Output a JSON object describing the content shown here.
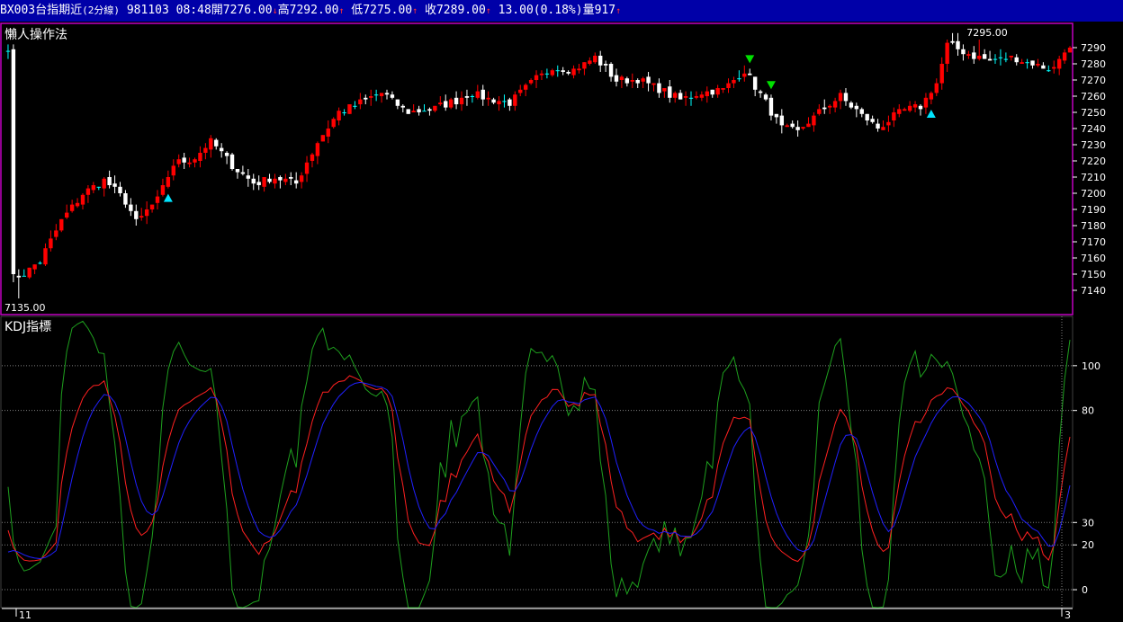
{
  "header": {
    "symbol": "BX003台指期近",
    "interval": "(2分線)",
    "date": "981103",
    "time": "08:48",
    "open_label": "開",
    "open": "7276.00",
    "high_label": "高",
    "high": "7292.00",
    "low_label": "低",
    "low": "7275.00",
    "close_label": "收",
    "close": "7289.00",
    "change": "13.00",
    "change_pct": "(0.18%)",
    "volume_label": "量",
    "volume": "917"
  },
  "colors": {
    "up": "#ff0000",
    "down": "#ffffff",
    "flat": "#00ffff",
    "k_line": "#ff2020",
    "d_line": "#2020ff",
    "j_line": "#1ea01e",
    "panel_border": "#c000c0",
    "buy_signal": "#00e5ff",
    "sell_signal": "#00e000",
    "header_bg": "#0000a8"
  },
  "chart_data": [
    {
      "type": "candlestick",
      "title": "懶人操作法",
      "ylim": [
        7125,
        7305
      ],
      "yticks": [
        7140,
        7150,
        7160,
        7170,
        7180,
        7190,
        7200,
        7210,
        7220,
        7230,
        7240,
        7250,
        7260,
        7270,
        7280,
        7290
      ],
      "annotations": [
        {
          "text": "7295.00",
          "bar": 182
        },
        {
          "text": "7135.00",
          "bar": 2
        }
      ],
      "signals": [
        {
          "bar": 30,
          "kind": "buy"
        },
        {
          "bar": 139,
          "kind": "sell"
        },
        {
          "bar": 143,
          "kind": "sell"
        },
        {
          "bar": 173,
          "kind": "buy"
        }
      ],
      "anchors": [
        [
          0,
          7288
        ],
        [
          2,
          7148
        ],
        [
          6,
          7158
        ],
        [
          10,
          7183
        ],
        [
          14,
          7200
        ],
        [
          18,
          7208
        ],
        [
          22,
          7195
        ],
        [
          24,
          7182
        ],
        [
          28,
          7196
        ],
        [
          31,
          7218
        ],
        [
          35,
          7222
        ],
        [
          38,
          7232
        ],
        [
          42,
          7217
        ],
        [
          46,
          7206
        ],
        [
          50,
          7210
        ],
        [
          54,
          7206
        ],
        [
          58,
          7232
        ],
        [
          62,
          7250
        ],
        [
          66,
          7256
        ],
        [
          70,
          7262
        ],
        [
          75,
          7250
        ],
        [
          79,
          7252
        ],
        [
          83,
          7256
        ],
        [
          87,
          7262
        ],
        [
          90,
          7258
        ],
        [
          94,
          7256
        ],
        [
          98,
          7268
        ],
        [
          102,
          7278
        ],
        [
          106,
          7276
        ],
        [
          110,
          7284
        ],
        [
          114,
          7270
        ],
        [
          118,
          7270
        ],
        [
          122,
          7264
        ],
        [
          126,
          7258
        ],
        [
          130,
          7262
        ],
        [
          134,
          7264
        ],
        [
          138,
          7276
        ],
        [
          142,
          7256
        ],
        [
          145,
          7240
        ],
        [
          148,
          7238
        ],
        [
          152,
          7250
        ],
        [
          156,
          7260
        ],
        [
          160,
          7248
        ],
        [
          163,
          7240
        ],
        [
          167,
          7250
        ],
        [
          171,
          7254
        ],
        [
          174,
          7268
        ],
        [
          176,
          7292
        ],
        [
          180,
          7286
        ],
        [
          184,
          7282
        ],
        [
          188,
          7284
        ],
        [
          192,
          7280
        ],
        [
          196,
          7277
        ],
        [
          198,
          7289
        ]
      ]
    },
    {
      "type": "line",
      "title": "KDJ指標",
      "ylim": [
        -8,
        122
      ],
      "yticks": [
        0,
        20,
        30,
        80,
        100
      ],
      "gridlines": [
        0,
        20,
        30,
        80,
        100
      ],
      "series": [
        {
          "name": "K",
          "key": "K"
        },
        {
          "name": "D",
          "key": "D"
        },
        {
          "name": "J",
          "key": "J"
        }
      ],
      "x_tick_labels": [
        {
          "text": "11",
          "bar": 2
        },
        {
          "text": "3",
          "bar": 196
        }
      ]
    }
  ]
}
